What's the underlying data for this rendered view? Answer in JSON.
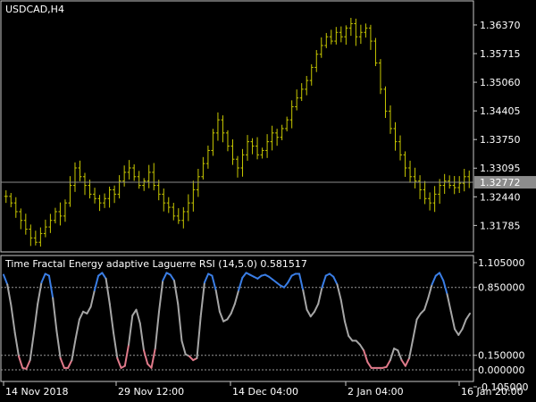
{
  "chart_data": [
    {
      "type": "bar",
      "chart_style": "ohlc-bars",
      "symbol_label": "USDCAD,H4",
      "bar_color": "#c8c800",
      "ylim": [
        1.312,
        1.369
      ],
      "yticks": [
        "1.36370",
        "1.35715",
        "1.35060",
        "1.34405",
        "1.33750",
        "1.33095",
        "1.32440",
        "1.31785"
      ],
      "current_price": "1.32772",
      "current_price_value": 1.32772,
      "closes": [
        1.3245,
        1.323,
        1.321,
        1.319,
        1.317,
        1.315,
        1.314,
        1.316,
        1.3175,
        1.319,
        1.321,
        1.32,
        1.323,
        1.327,
        1.331,
        1.329,
        1.327,
        1.325,
        1.324,
        1.323,
        1.324,
        1.326,
        1.325,
        1.328,
        1.33,
        1.331,
        1.329,
        1.327,
        1.328,
        1.33,
        1.327,
        1.325,
        1.323,
        1.322,
        1.32,
        1.319,
        1.321,
        1.323,
        1.326,
        1.329,
        1.332,
        1.335,
        1.339,
        1.342,
        1.339,
        1.336,
        1.333,
        1.331,
        1.334,
        1.337,
        1.336,
        1.334,
        1.335,
        1.337,
        1.339,
        1.338,
        1.34,
        1.342,
        1.345,
        1.347,
        1.349,
        1.351,
        1.354,
        1.357,
        1.359,
        1.361,
        1.36,
        1.362,
        1.361,
        1.363,
        1.364,
        1.361,
        1.362,
        1.363,
        1.36,
        1.355,
        1.349,
        1.344,
        1.34,
        1.337,
        1.334,
        1.331,
        1.329,
        1.328,
        1.326,
        1.324,
        1.323,
        1.325,
        1.327,
        1.328,
        1.327,
        1.3265,
        1.3275,
        1.329,
        1.3277
      ]
    },
    {
      "type": "line",
      "title": "Time Fractal Energy adaptive Laguerre RSI (14,5.0) 0.581517",
      "ylim": [
        0.0,
        1.105
      ],
      "yticks": [
        "1.105000",
        "0.850000",
        "0.150000",
        "0.000000",
        "-0.105000"
      ],
      "levels": [
        0.85,
        0.15
      ],
      "colors": {
        "neutral": "#a6a6a6",
        "overbought": "#3a7ee6",
        "oversold": "#e07a8a"
      },
      "values": [
        0.98,
        0.88,
        0.66,
        0.38,
        0.14,
        0.02,
        0.01,
        0.1,
        0.38,
        0.68,
        0.9,
        0.99,
        0.97,
        0.74,
        0.4,
        0.12,
        0.02,
        0.02,
        0.1,
        0.32,
        0.52,
        0.6,
        0.58,
        0.65,
        0.82,
        0.97,
        1.0,
        0.94,
        0.68,
        0.38,
        0.12,
        0.02,
        0.04,
        0.26,
        0.56,
        0.62,
        0.48,
        0.2,
        0.06,
        0.02,
        0.22,
        0.6,
        0.92,
        1.0,
        0.98,
        0.92,
        0.68,
        0.3,
        0.16,
        0.14,
        0.1,
        0.12,
        0.55,
        0.9,
        0.99,
        0.97,
        0.82,
        0.6,
        0.5,
        0.52,
        0.58,
        0.68,
        0.82,
        0.95,
        1.0,
        0.98,
        0.96,
        0.94,
        0.97,
        0.98,
        0.96,
        0.93,
        0.9,
        0.87,
        0.85,
        0.9,
        0.97,
        0.99,
        0.99,
        0.82,
        0.62,
        0.55,
        0.6,
        0.68,
        0.85,
        0.97,
        0.99,
        0.96,
        0.88,
        0.72,
        0.5,
        0.35,
        0.3,
        0.3,
        0.26,
        0.2,
        0.08,
        0.02,
        0.02,
        0.02,
        0.02,
        0.03,
        0.1,
        0.22,
        0.2,
        0.1,
        0.04,
        0.12,
        0.32,
        0.52,
        0.58,
        0.62,
        0.74,
        0.88,
        0.97,
        1.0,
        0.92,
        0.78,
        0.6,
        0.42,
        0.36,
        0.42,
        0.52,
        0.58
      ]
    }
  ],
  "xaxis": {
    "ticks": [
      "14 Nov 2018",
      "29 Nov 12:00",
      "14 Dec 04:00",
      "2 Jan 04:00",
      "16 Jan 20:00"
    ]
  }
}
